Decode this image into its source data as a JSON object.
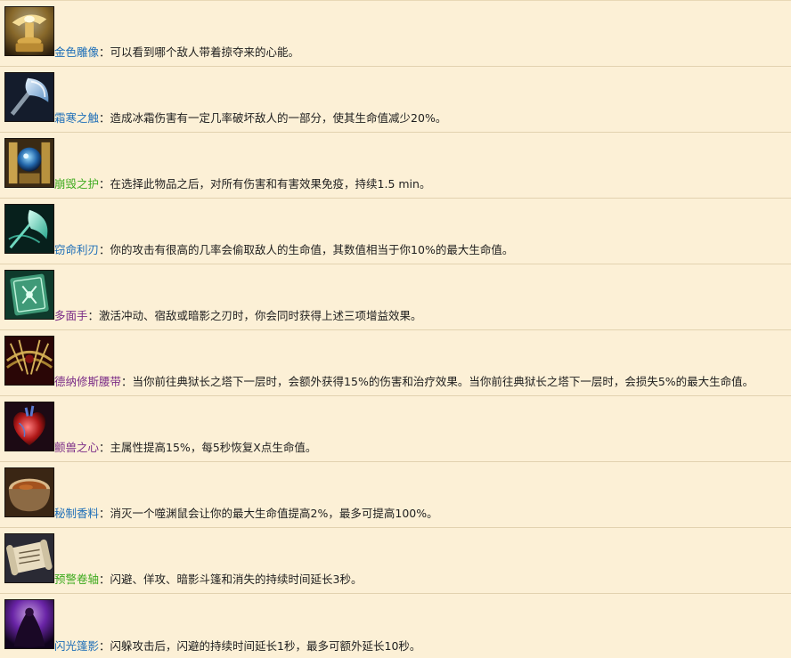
{
  "colors": {
    "background": "#fcf0d6",
    "divider": "#e2d2b0",
    "text": "#1e1e1e",
    "rare_blue": "#1f6fb8",
    "uncommon_green": "#3daa1e",
    "epic_purple": "#7a2b86"
  },
  "separator": "：",
  "items": [
    {
      "icon": "golden-statue-icon",
      "name": "金色雕像",
      "name_color": "#1f6fb8",
      "description": "可以看到哪个敌人带着掠夺来的心能。"
    },
    {
      "icon": "frost-axe-icon",
      "name": "霜寒之触",
      "name_color": "#1f6fb8",
      "description": "造成冰霜伤害有一定几率破坏敌人的一部分，使其生命值减少20%。"
    },
    {
      "icon": "crystal-orb-shield-icon",
      "name": "崩毁之护",
      "name_color": "#3daa1e",
      "description": "在选择此物品之后，对所有伤害和有害效果免疫，持续1.5 min。"
    },
    {
      "icon": "spectral-blade-icon",
      "name": "窃命利刃",
      "name_color": "#1f6fb8",
      "description": "你的攻击有很高的几率会偷取敌人的生命值，其数值相当于你10%的最大生命值。"
    },
    {
      "icon": "rune-card-icon",
      "name": "多面手",
      "name_color": "#7a2b86",
      "description": "激活冲动、宿敌或暗影之刃时，你会同时获得上述三项增益效果。"
    },
    {
      "icon": "thorn-belt-icon",
      "name": "德纳修斯腰带",
      "name_color": "#7a2b86",
      "description": "当你前往典狱长之塔下一层时，会额外获得15%的伤害和治疗效果。当你前往典狱长之塔下一层时，会损失5%的最大生命值。"
    },
    {
      "icon": "beast-heart-icon",
      "name": "颤兽之心",
      "name_color": "#7a2b86",
      "description": "主属性提高15%，每5秒恢复X点生命值。"
    },
    {
      "icon": "spice-bowl-icon",
      "name": "秘制香料",
      "name_color": "#1f6fb8",
      "description": "消灭一个噬渊鼠会让你的最大生命值提高2%，最多可提高100%。"
    },
    {
      "icon": "scroll-icon",
      "name": "预警卷轴",
      "name_color": "#3daa1e",
      "description": "闪避、佯攻、暗影斗篷和消失的持续时间延长3秒。"
    },
    {
      "icon": "shadow-cloak-icon",
      "name": "闪光篷影",
      "name_color": "#1f6fb8",
      "description": "闪躲攻击后，闪避的持续时间延长1秒，最多可额外延长10秒。"
    }
  ]
}
